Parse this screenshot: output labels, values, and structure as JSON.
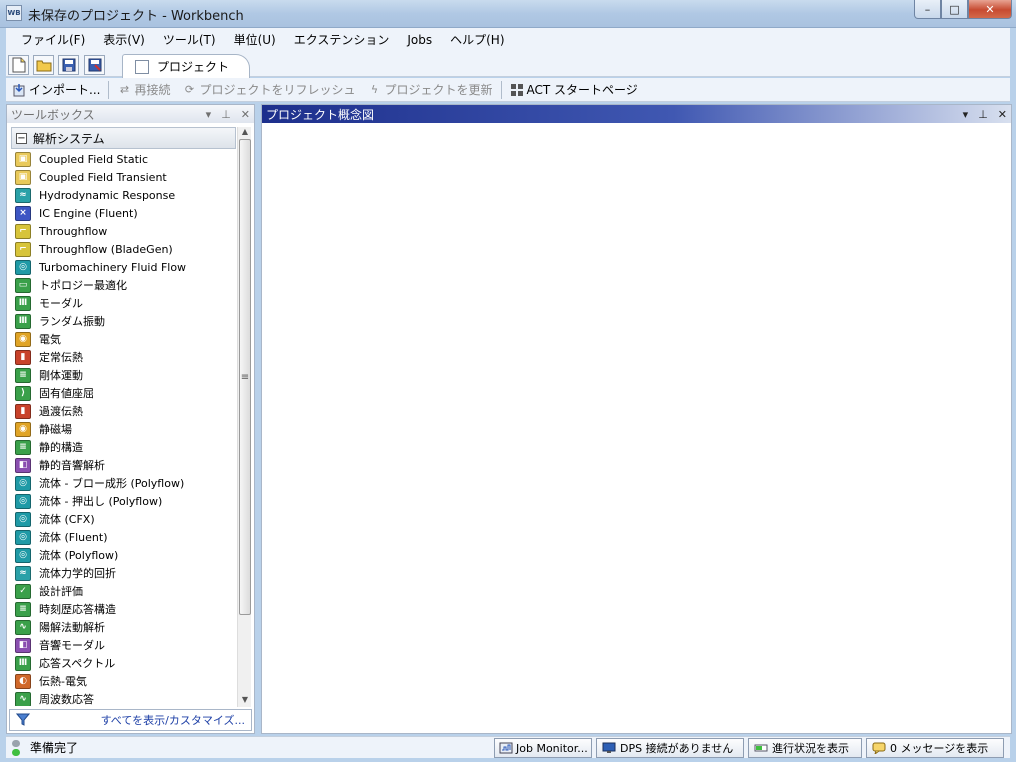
{
  "window": {
    "title": "未保存のプロジェクト - Workbench",
    "app_icon_text": "WB",
    "minimize": "–",
    "maximize": "□",
    "close": "✕"
  },
  "menu": [
    "ファイル(F)",
    "表示(V)",
    "ツール(T)",
    "単位(U)",
    "エクステンション",
    "Jobs",
    "ヘルプ(H)"
  ],
  "tabs": {
    "project": "プロジェクト"
  },
  "toolbar": {
    "import": "インポート...",
    "reconnect": "再接続",
    "refresh": "プロジェクトをリフレッシュ",
    "update": "プロジェクトを更新",
    "act_start": "ACT スタートページ"
  },
  "toolbox": {
    "title": "ツールボックス",
    "group": "解析システム",
    "footer": "すべてを表示/カスタマイズ...",
    "items": [
      {
        "label": "Coupled Field Static",
        "color": "#e9c95a",
        "glyph": "▣"
      },
      {
        "label": "Coupled Field Transient",
        "color": "#e9c95a",
        "glyph": "▣"
      },
      {
        "label": "Hydrodynamic Response",
        "color": "#2aa1a8",
        "glyph": "≈"
      },
      {
        "label": "IC Engine (Fluent)",
        "color": "#3d56c4",
        "glyph": "⨯"
      },
      {
        "label": "Throughflow",
        "color": "#d7c43a",
        "glyph": "⌐"
      },
      {
        "label": "Throughflow (BladeGen)",
        "color": "#d7c43a",
        "glyph": "⌐"
      },
      {
        "label": "Turbomachinery Fluid Flow",
        "color": "#1f9aa6",
        "glyph": "◎"
      },
      {
        "label": "トポロジー最適化",
        "color": "#3aa04a",
        "glyph": "▭"
      },
      {
        "label": "モーダル",
        "color": "#3aa04a",
        "glyph": "Ⅲ"
      },
      {
        "label": "ランダム振動",
        "color": "#3aa04a",
        "glyph": "Ⅲ"
      },
      {
        "label": "電気",
        "color": "#e0a426",
        "glyph": "◉"
      },
      {
        "label": "定常伝熱",
        "color": "#c8422a",
        "glyph": "▮"
      },
      {
        "label": "剛体運動",
        "color": "#3aa04a",
        "glyph": "≡"
      },
      {
        "label": "固有値座屈",
        "color": "#3aa04a",
        "glyph": "⟩"
      },
      {
        "label": "過渡伝熱",
        "color": "#c8422a",
        "glyph": "▮"
      },
      {
        "label": "静磁場",
        "color": "#e0a426",
        "glyph": "◉"
      },
      {
        "label": "静的構造",
        "color": "#3aa04a",
        "glyph": "≡"
      },
      {
        "label": "静的音響解析",
        "color": "#8a4fb0",
        "glyph": "◧"
      },
      {
        "label": "流体 - ブロー成形 (Polyflow)",
        "color": "#1f9aa6",
        "glyph": "◎"
      },
      {
        "label": "流体 - 押出し (Polyflow)",
        "color": "#1f9aa6",
        "glyph": "◎"
      },
      {
        "label": "流体 (CFX)",
        "color": "#1f9aa6",
        "glyph": "◎"
      },
      {
        "label": "流体 (Fluent)",
        "color": "#1f9aa6",
        "glyph": "◎"
      },
      {
        "label": "流体 (Polyflow)",
        "color": "#1f9aa6",
        "glyph": "◎"
      },
      {
        "label": "流体力学的回折",
        "color": "#2aa1a8",
        "glyph": "≈"
      },
      {
        "label": "設計評価",
        "color": "#3aa04a",
        "glyph": "✓"
      },
      {
        "label": "時刻歴応答構造",
        "color": "#3aa04a",
        "glyph": "≡"
      },
      {
        "label": "陽解法動解析",
        "color": "#3aa04a",
        "glyph": "∿"
      },
      {
        "label": "音響モーダル",
        "color": "#8a4fb0",
        "glyph": "◧"
      },
      {
        "label": "応答スペクトル",
        "color": "#3aa04a",
        "glyph": "Ⅲ"
      },
      {
        "label": "伝熱-電気",
        "color": "#d0682a",
        "glyph": "◐"
      },
      {
        "label": "周波数応答",
        "color": "#3aa04a",
        "glyph": "∿"
      }
    ]
  },
  "schematic": {
    "title": "プロジェクト概念図"
  },
  "status": {
    "text": "準備完了",
    "job_monitor": "Job Monitor...",
    "dps": "DPS 接続がありません",
    "progress": "進行状況を表示",
    "messages": "0 メッセージを表示"
  }
}
